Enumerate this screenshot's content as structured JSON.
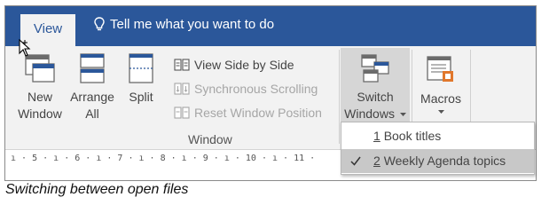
{
  "ribbon_tabs": {
    "active_tab": "View"
  },
  "tell_me": {
    "text": "Tell me what you want to do"
  },
  "window_group": {
    "new_window": [
      "New",
      "Window"
    ],
    "arrange_all": [
      "Arrange",
      "All"
    ],
    "split": "Split",
    "view_side_by_side": "View Side by Side",
    "synchronous_scrolling": "Synchronous Scrolling",
    "reset_window_position": "Reset Window Position",
    "switch_windows": [
      "Switch",
      "Windows"
    ],
    "group_label": "Window"
  },
  "macros_group": {
    "macros": "Macros"
  },
  "ruler": {
    "marks": "ı · 5 · ı · 6 · ı · 7 · ı · 8 · ı · 9 · ı · 10 · ı · 11 ·"
  },
  "switch_windows_menu": {
    "items": [
      {
        "number": "1",
        "label": "Book titles",
        "checked": false
      },
      {
        "number": "2",
        "label": "Weekly Agenda topics",
        "checked": true
      }
    ]
  },
  "caption": "Switching between open files",
  "colors": {
    "tab_bar": "#2b579a",
    "ribbon": "#f2f2f2",
    "accent_orange": "#e1772c"
  }
}
